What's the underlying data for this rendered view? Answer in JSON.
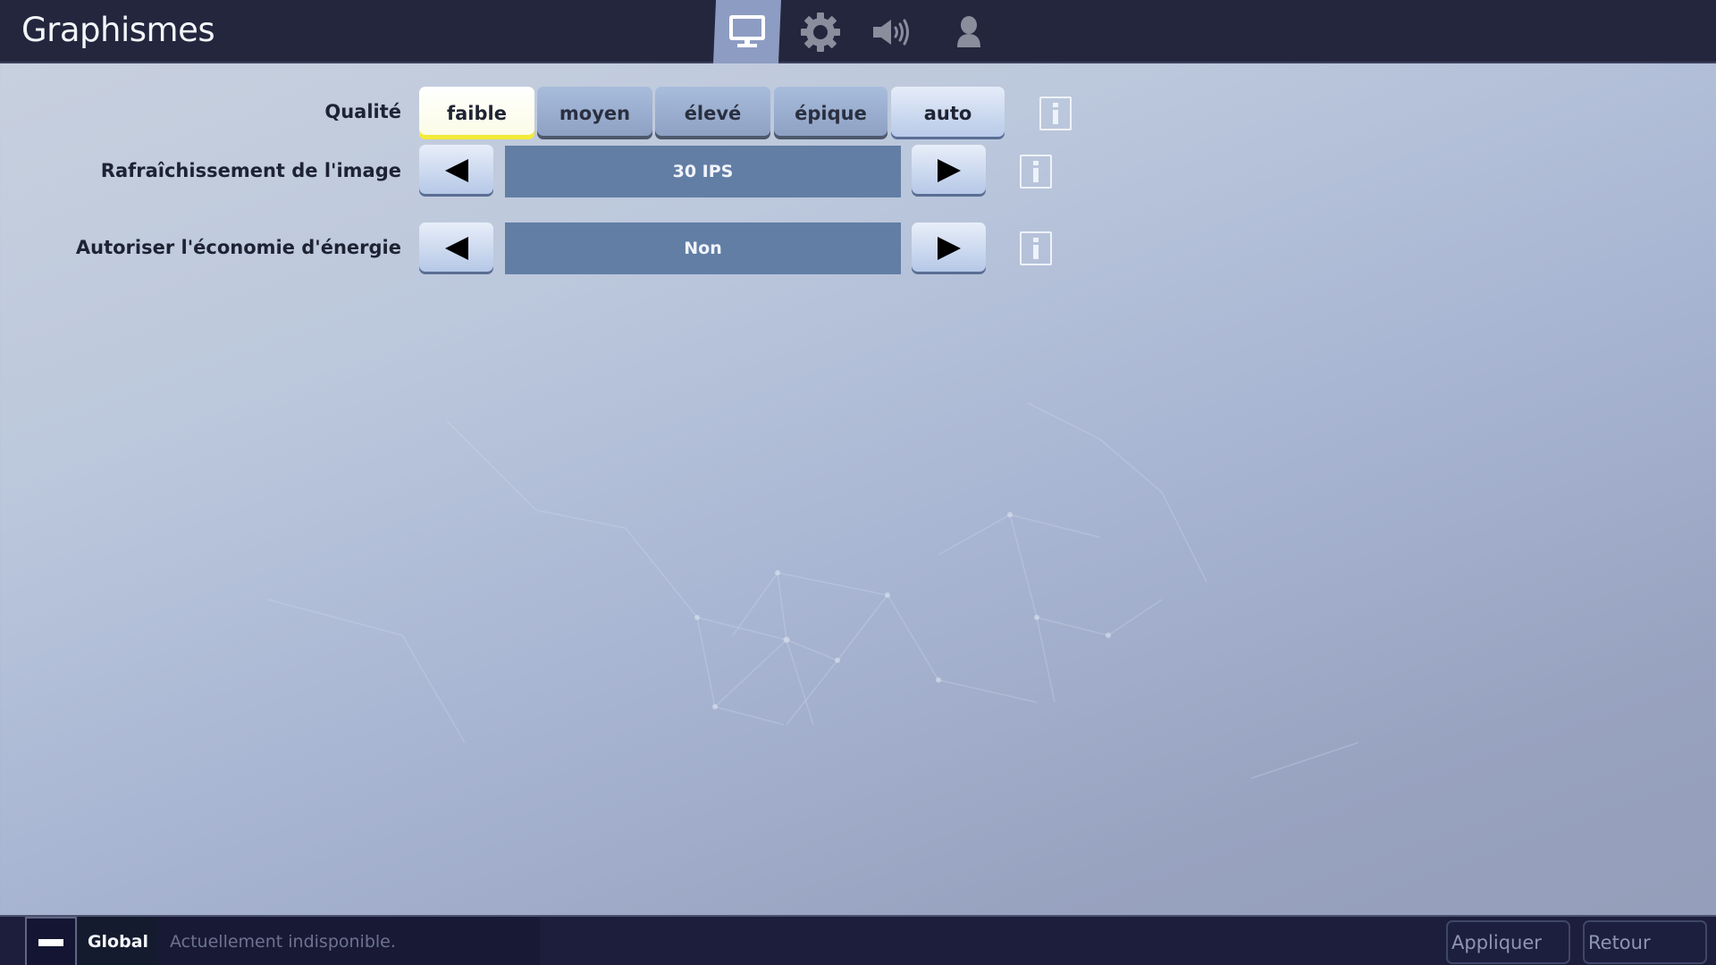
{
  "header": {
    "title": "Graphismes",
    "tabs": [
      {
        "name": "display",
        "icon": "monitor-icon",
        "active": true
      },
      {
        "name": "game",
        "icon": "gear-icon",
        "active": false
      },
      {
        "name": "audio",
        "icon": "speaker-icon",
        "active": false
      },
      {
        "name": "account",
        "icon": "person-icon",
        "active": false
      }
    ]
  },
  "settings": {
    "quality": {
      "label": "Qualité",
      "options": [
        "faible",
        "moyen",
        "élevé",
        "épique",
        "auto"
      ],
      "selected": "faible"
    },
    "frame_rate": {
      "label": "Rafraîchissement de l'image",
      "value": "30 IPS"
    },
    "power_saving": {
      "label": "Autoriser l'économie d'énergie",
      "value": "Non"
    }
  },
  "footer": {
    "channel": "Global",
    "status": "Actuellement indisponible.",
    "apply_label": "Appliquer",
    "back_label": "Retour"
  },
  "colors": {
    "header_bg": "#23263d",
    "active_tab": "#8d9cc2",
    "selected_underline": "#f2ea37",
    "value_box": "#627ea5",
    "footer_bg": "#1c1e3c"
  }
}
